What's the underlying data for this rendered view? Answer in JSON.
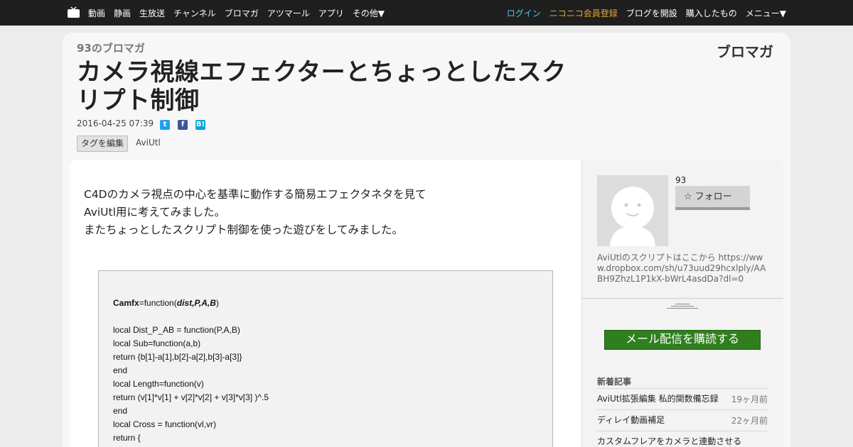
{
  "nav": {
    "left": [
      "動画",
      "静画",
      "生放送",
      "チャンネル",
      "ブロマガ",
      "アツマール",
      "アプリ",
      "その他▼"
    ],
    "login": "ログイン",
    "register": "ニコニコ会員登録",
    "open_blog": "ブログを開設",
    "purchased": "購入したもの",
    "menu": "メニュー▼"
  },
  "header": {
    "blog_name": "93のブロマガ",
    "logo": "ブロマガ",
    "title": "カメラ視線エフェクターとちょっとしたスクリプト制御",
    "date": "2016-04-25 07:39",
    "tag_edit": "タグを編集",
    "tag": "AviUtl"
  },
  "share": {
    "twitter": "t",
    "facebook": "f",
    "hatena": "B!"
  },
  "article": {
    "lead": [
      "C4Dのカメラ視点の中心を基準に動作する簡易エフェクタネタを見て",
      "AviUtl用に考えてみました。",
      "またちょっとしたスクリプト制御を使った遊びをしてみました。"
    ],
    "code_head": {
      "name": "Camfx",
      "mid": "=function(",
      "args": "dist,P,A,B",
      "end": ")"
    },
    "code_lines": [
      "",
      "local Dist_P_AB = function(P,A,B)",
      "local Sub=function(a,b)",
      "return {b[1]-a[1],b[2]-a[2],b[3]-a[3]}",
      "end",
      "local Length=function(v)",
      "return (v[1]*v[1] + v[2]*v[2] + v[3]*v[3] )^.5",
      "end",
      "local Cross = function(vl,vr)",
      "return {"
    ]
  },
  "sidebar": {
    "author": "93",
    "follow": "フォロー",
    "profile": "AviUtlのスクリプトはここから https://www.dropbox.com/sh/u73uud29hcxlply/AABH9ZhzL1P1kX-bWrL4asdDa?dl=0",
    "subscribe": "メール配信を購読する",
    "new_head": "新着記事",
    "new_items": [
      {
        "title": "AviUtl拡張編集 私的関数備忘録",
        "date": "19ヶ月前"
      },
      {
        "title": "ディレイ動画補足",
        "date": "22ヶ月前"
      },
      {
        "title": "カスタムフレアをカメラと連動させる",
        "date": ""
      }
    ]
  }
}
